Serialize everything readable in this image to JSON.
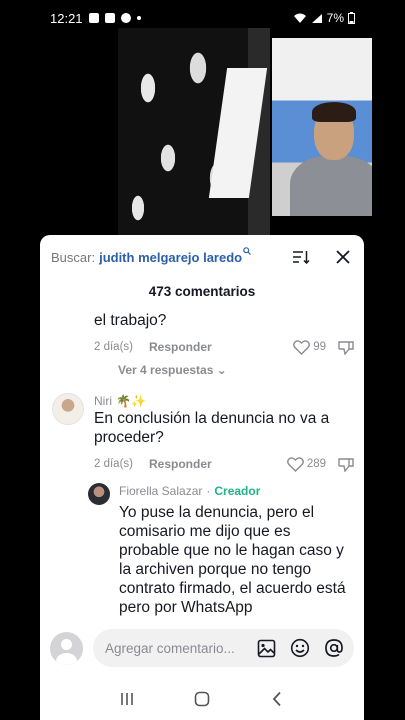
{
  "status_bar": {
    "time": "12:21",
    "battery": "7%"
  },
  "header": {
    "search_prefix": "Buscar:",
    "search_term": "judith melgarejo laredo",
    "search_icon": "search-icon",
    "sort_icon": "sort-icon",
    "close_icon": "close-icon"
  },
  "comment_count": "473 comentarios",
  "comments": [
    {
      "text": "el trabajo?",
      "age": "2 día(s)",
      "reply_label": "Responder",
      "likes": "99"
    },
    {
      "username": "Niri",
      "username_emoji": "🌴✨",
      "text": "En conclusión la denuncia no va a proceder?",
      "age": "2 día(s)",
      "reply_label": "Responder",
      "likes": "289"
    },
    {
      "username": "Fiorella Salazar",
      "separator": "·",
      "badge": "Creador",
      "text": "Yo puse la denuncia, pero el comisario me dijo que es probable que no le hagan caso y la archiven porque no tengo contrato firmado, el acuerdo está pero por WhatsApp"
    }
  ],
  "view_more": "Ver 4 respuestas ⌄",
  "composer": {
    "placeholder": "Agregar comentario...",
    "icons": [
      "image-icon",
      "emoji-icon",
      "mention-icon"
    ]
  },
  "colors": {
    "link": "#2b5fa8",
    "creator": "#20b28a",
    "muted": "#8a8b91"
  }
}
